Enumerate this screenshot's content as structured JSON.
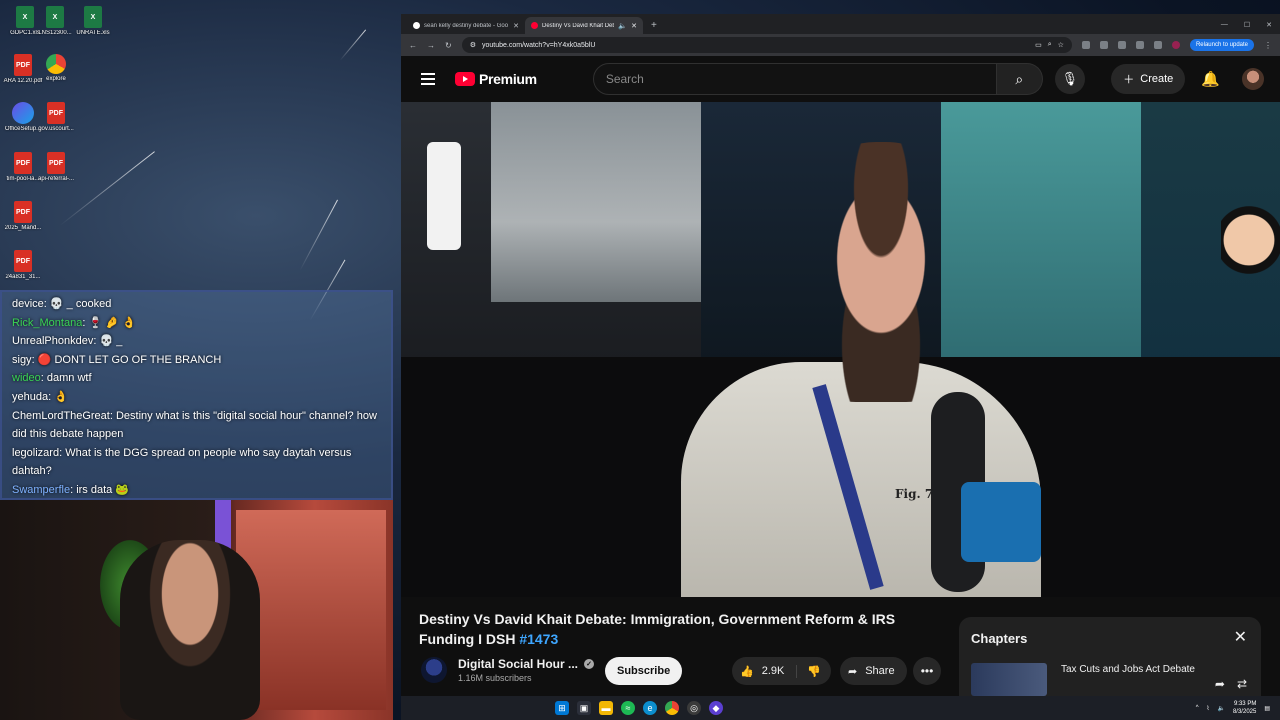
{
  "desktop_icons": [
    {
      "label": "GDPC1.xls",
      "kind": "xls"
    },
    {
      "label": "LNS12300...",
      "kind": "xls"
    },
    {
      "label": "UNRATE.xls",
      "kind": "xls"
    },
    {
      "label": "ARA 12.20.pdf",
      "kind": "pdf"
    },
    {
      "label": "explore",
      "kind": "chrome"
    },
    {
      "label": "OfficeSetup...",
      "kind": "office"
    },
    {
      "label": "gov.uscourt...",
      "kind": "pdf"
    },
    {
      "label": "tim-pool-la...",
      "kind": "pdf"
    },
    {
      "label": "api-referral-...",
      "kind": "pdf"
    },
    {
      "label": "2025_Mand...",
      "kind": "pdf"
    },
    {
      "label": "24a831_31...",
      "kind": "pdf"
    }
  ],
  "chat": {
    "messages": [
      {
        "user": "device",
        "text": "💀 _ cooked",
        "color": "white"
      },
      {
        "user": "Rick_Montana",
        "text": "🍷 🤌 👌",
        "color": "green"
      },
      {
        "user": "UnrealPhonkdev",
        "text": "💀 _",
        "color": "white"
      },
      {
        "user": "sigy",
        "text": "🔴 DONT LET GO OF THE BRANCH",
        "color": "white"
      },
      {
        "user": "wideo",
        "text": "damn wtf",
        "color": "green"
      },
      {
        "user": "yehuda",
        "text": "👌",
        "color": "white"
      },
      {
        "user": "ChemLordTheGreat",
        "text": "Destiny what is this \"digital social hour\" channel? how did this debate happen",
        "color": "white"
      },
      {
        "user": "legolizard",
        "text": "What is the DGG spread on people who say daytah versus dahtah?",
        "color": "white"
      },
      {
        "user": "Swamperfle",
        "text": "irs data 🐸",
        "color": "blue"
      }
    ]
  },
  "browser": {
    "tabs": [
      {
        "title": "sean kelly destiny debate - Goo",
        "active": false,
        "favicon": "google"
      },
      {
        "title": "Destiny Vs David Khait Deb",
        "active": true,
        "favicon": "youtube"
      }
    ],
    "new_tab": "+",
    "url": "youtube.com/watch?v=hY4xk0a5blU",
    "relaunch_label": "Relaunch to update"
  },
  "youtube": {
    "logo_text": "Premium",
    "search_placeholder": "Search",
    "create_label": "Create",
    "video": {
      "title": "Destiny Vs David Khait Debate: Immigration, Government Reform & IRS Funding I DSH ",
      "title_tag": "#1473",
      "overlay_text": "Fig. 7"
    },
    "channel": {
      "name": "Digital Social Hour ...",
      "subscribers": "1.16M subscribers",
      "subscribe_label": "Subscribe"
    },
    "likes": "2.9K",
    "share_label": "Share",
    "chapters": {
      "heading": "Chapters",
      "items": [
        {
          "title": "Tax Cuts and Jobs Act Debate"
        }
      ]
    }
  },
  "taskbar": {
    "time": "9:33 PM",
    "date": "8/3/2025"
  },
  "colors": {
    "youtube_red": "#ff0033",
    "link_blue": "#3ea6ff",
    "chrome_blue": "#1a73e8",
    "chat_green": "#39d353"
  }
}
